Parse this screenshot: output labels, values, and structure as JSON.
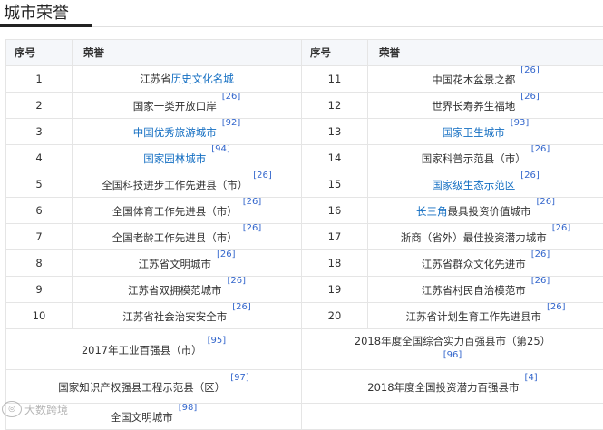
{
  "page": {
    "heading": "城市荣誉",
    "watermark": "大数跨境"
  },
  "table": {
    "headers": {
      "index": "序号",
      "honor": "荣誉"
    },
    "left": [
      {
        "index": "1",
        "prefix": "江苏省",
        "link": "历史文化名城",
        "suffix": "",
        "ref": ""
      },
      {
        "index": "2",
        "prefix": "国家一类开放口岸",
        "link": "",
        "suffix": "",
        "ref": "[26]"
      },
      {
        "index": "3",
        "prefix": "",
        "link": "中国优秀旅游城市",
        "suffix": "",
        "ref": "[92]"
      },
      {
        "index": "4",
        "prefix": "",
        "link": "国家园林城市",
        "suffix": "",
        "ref": "[94]"
      },
      {
        "index": "5",
        "prefix": "全国科技进步工作先进县（市）",
        "link": "",
        "suffix": "",
        "ref": "[26]"
      },
      {
        "index": "6",
        "prefix": "全国体育工作先进县（市）",
        "link": "",
        "suffix": "",
        "ref": "[26]"
      },
      {
        "index": "7",
        "prefix": "全国老龄工作先进县（市）",
        "link": "",
        "suffix": "",
        "ref": "[26]"
      },
      {
        "index": "8",
        "prefix": "江苏省文明城市",
        "link": "",
        "suffix": "",
        "ref": "[26]"
      },
      {
        "index": "9",
        "prefix": "江苏省双拥模范城市",
        "link": "",
        "suffix": "",
        "ref": "[26]"
      },
      {
        "index": "10",
        "prefix": "江苏省社会治安安全市",
        "link": "",
        "suffix": "",
        "ref": "[26]"
      }
    ],
    "right": [
      {
        "index": "11",
        "prefix": "中国花木盆景之都",
        "link": "",
        "suffix": "",
        "ref": "[26]"
      },
      {
        "index": "12",
        "prefix": "世界长寿养生福地",
        "link": "",
        "suffix": "",
        "ref": "[26]"
      },
      {
        "index": "13",
        "prefix": "",
        "link": "国家卫生城市",
        "suffix": "",
        "ref": "[93]"
      },
      {
        "index": "14",
        "prefix": "国家科普示范县（市）",
        "link": "",
        "suffix": "",
        "ref": "[26]"
      },
      {
        "index": "15",
        "prefix": "",
        "link": "国家级生态示范区",
        "suffix": "",
        "ref": "[26]"
      },
      {
        "index": "16",
        "prefix": "",
        "link": "长三角",
        "suffix": "最具投资价值城市",
        "ref": "[26]"
      },
      {
        "index": "17",
        "prefix": "浙商（省外）最佳投资潜力城市",
        "link": "",
        "suffix": "",
        "ref": "[26]"
      },
      {
        "index": "18",
        "prefix": "江苏省群众文化先进市",
        "link": "",
        "suffix": "",
        "ref": "[26]"
      },
      {
        "index": "19",
        "prefix": "江苏省村民自治模范市",
        "link": "",
        "suffix": "",
        "ref": "[26]"
      },
      {
        "index": "20",
        "prefix": "江苏省计划生育工作先进县市",
        "link": "",
        "suffix": "",
        "ref": "[26]"
      }
    ],
    "extra": [
      {
        "left": "2017年工业百强县（市）",
        "left_ref": "[95]",
        "right": "2018年度全国综合实力百强县市（第25）",
        "right_ref": "[96]"
      },
      {
        "left": "国家知识产权强县工程示范县（区）",
        "left_ref": "[97]",
        "right": "2018年度全国投资潜力百强县市",
        "right_ref": "[4]"
      },
      {
        "left": "全国文明城市",
        "left_ref": "[98]",
        "right": "",
        "right_ref": ""
      }
    ]
  }
}
